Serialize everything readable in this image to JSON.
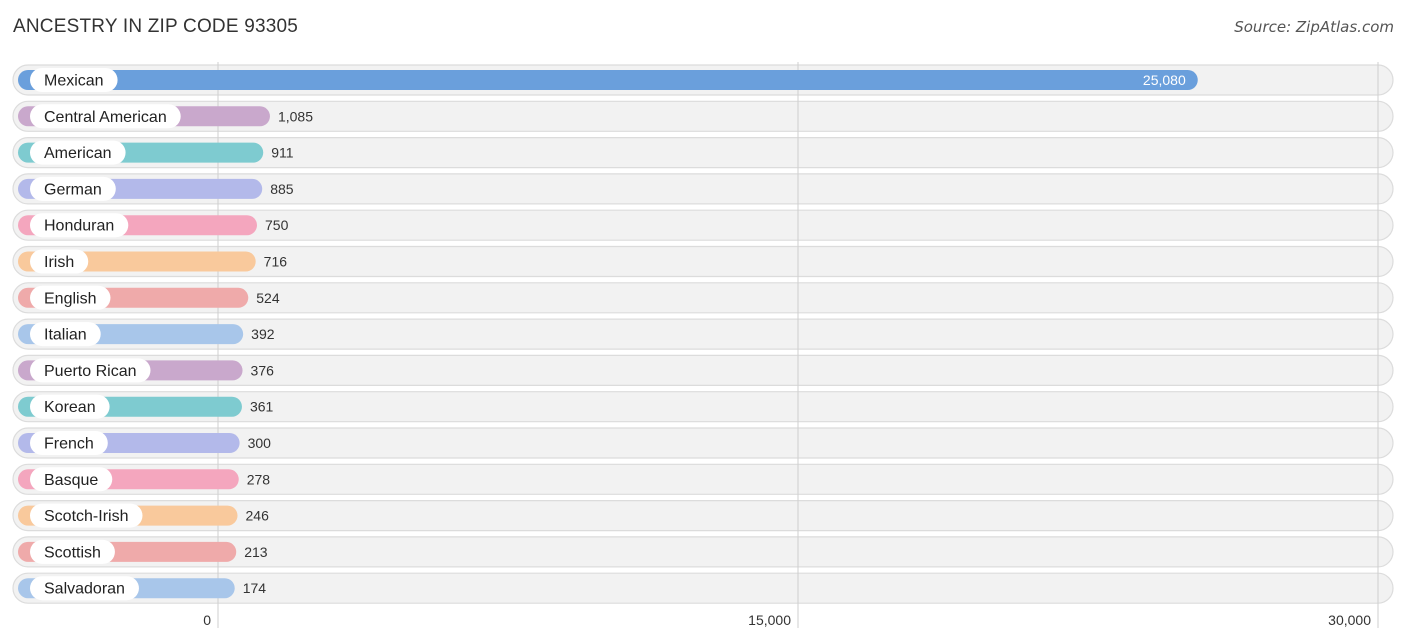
{
  "header": {
    "title": "ANCESTRY IN ZIP CODE 93305",
    "source": "Source: ZipAtlas.com"
  },
  "chart_data": {
    "type": "bar",
    "orientation": "horizontal",
    "title": "ANCESTRY IN ZIP CODE 93305",
    "xlabel": "",
    "ylabel": "",
    "xlim": [
      0,
      30000
    ],
    "grid": true,
    "x_ticks": [
      0,
      15000,
      30000
    ],
    "x_tick_labels": [
      "0",
      "15,000",
      "30,000"
    ],
    "categories": [
      "Mexican",
      "Central American",
      "American",
      "German",
      "Honduran",
      "Irish",
      "English",
      "Italian",
      "Puerto Rican",
      "Korean",
      "French",
      "Basque",
      "Scotch-Irish",
      "Scottish",
      "Salvadoran"
    ],
    "values": [
      25080,
      1085,
      911,
      885,
      750,
      716,
      524,
      392,
      376,
      361,
      300,
      278,
      246,
      213,
      174
    ],
    "value_labels": [
      "25,080",
      "1,085",
      "911",
      "885",
      "750",
      "716",
      "524",
      "392",
      "376",
      "361",
      "300",
      "278",
      "246",
      "213",
      "174"
    ],
    "colors": [
      "#6a9fdc",
      "#c9a8cc",
      "#7ecbd0",
      "#b3b9ea",
      "#f4a6be",
      "#f9c99c",
      "#efaaaa",
      "#a8c6ea",
      "#c9a8cc",
      "#7ecbd0",
      "#b3b9ea",
      "#f4a6be",
      "#f9c99c",
      "#efaaaa",
      "#a8c6ea"
    ]
  }
}
